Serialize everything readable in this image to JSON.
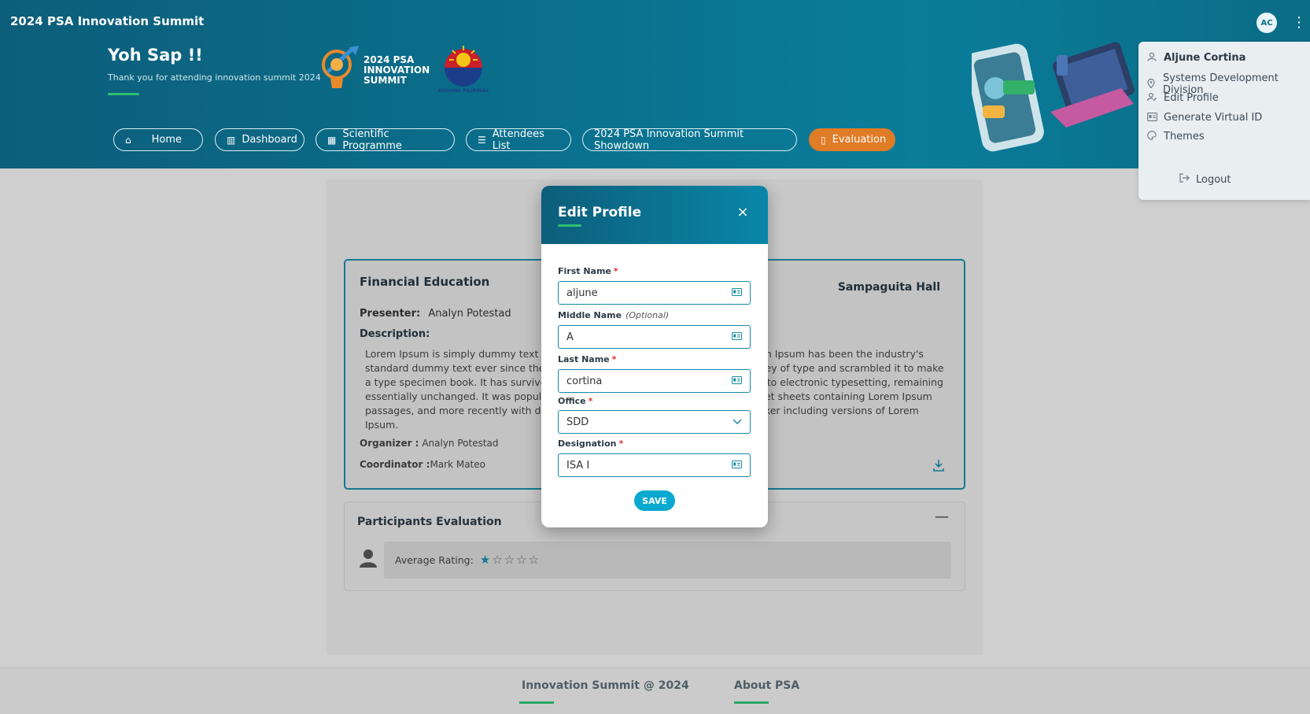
{
  "app": {
    "title": "2024 PSA Innovation Summit"
  },
  "header": {
    "greeting": "Yoh Sap !!",
    "subtitle": "Thank you for attending innovation summit 2024",
    "summit_logo_text": "2024 PSA INNOVATION SUMMIT",
    "bagong_logo_text": "BAGONG PILIPINAS",
    "avatar_initials": "AC",
    "kebab_icon": "⋮"
  },
  "nav": [
    {
      "label": "Home",
      "icon": "home-icon",
      "glyph": "⌂"
    },
    {
      "label": "Dashboard",
      "icon": "chart-icon",
      "glyph": "▥"
    },
    {
      "label": "Scientific Programme",
      "icon": "calendar-icon",
      "glyph": "▦"
    },
    {
      "label": "Attendees List",
      "icon": "list-icon",
      "glyph": "☰"
    },
    {
      "label": "2024 PSA Innovation Summit Showdown",
      "icon": "",
      "glyph": ""
    },
    {
      "label": "Evaluation",
      "icon": "document-icon",
      "glyph": "▯",
      "active": true
    }
  ],
  "menu": {
    "user_name": "Aljune Cortina",
    "division": "Systems Development Division",
    "edit_profile": "Edit Profile",
    "virtual_id": "Generate Virtual ID",
    "themes": "Themes",
    "logout": "Logout"
  },
  "session": {
    "title": "Financial Education",
    "hall": "Sampaguita Hall",
    "presenter_label": "Presenter:",
    "presenter": "Analyn Potestad",
    "description_label": "Description:",
    "description": "Lorem Ipsum is simply dummy text of the printing and typesetting industry. Lorem Ipsum has been the industry's standard dummy text ever since the 1500s, when an unknown printer took a galley of type and scrambled it to make a type specimen book. It has survived not only five centuries, but also the leap into electronic typesetting, remaining essentially unchanged. It was popularised in the 1960s with the release of Letraset sheets containing Lorem Ipsum passages, and more recently with desktop publishing software like Aldus PageMaker including versions of Lorem Ipsum.",
    "organizer_label": "Organizer :",
    "organizer": "Analyn Potestad",
    "coordinator_label": "Coordinator :",
    "coordinator": "Mark Mateo"
  },
  "evaluation": {
    "title": "Participants Evaluation",
    "rating_label": "Average Rating:",
    "rating": 1,
    "max_rating": 5
  },
  "footer": {
    "link1": "Innovation Summit @ 2024",
    "link2": "About PSA"
  },
  "modal": {
    "title": "Edit Profile",
    "close": "×",
    "first_name_label": "First Name",
    "first_name": "aljune",
    "middle_name_label": "Middle Name",
    "middle_name_hint": "(Optional)",
    "middle_name": "A",
    "last_name_label": "Last Name",
    "last_name": "cortina",
    "office_label": "Office",
    "office": "SDD",
    "designation_label": "Designation",
    "designation": "ISA I",
    "save": "SAVE",
    "required_mark": "*"
  },
  "colors": {
    "accent": "#168aa6",
    "active_nav": "#e07b26",
    "header": "#0a6f8c",
    "underline": "#2fbf71"
  }
}
